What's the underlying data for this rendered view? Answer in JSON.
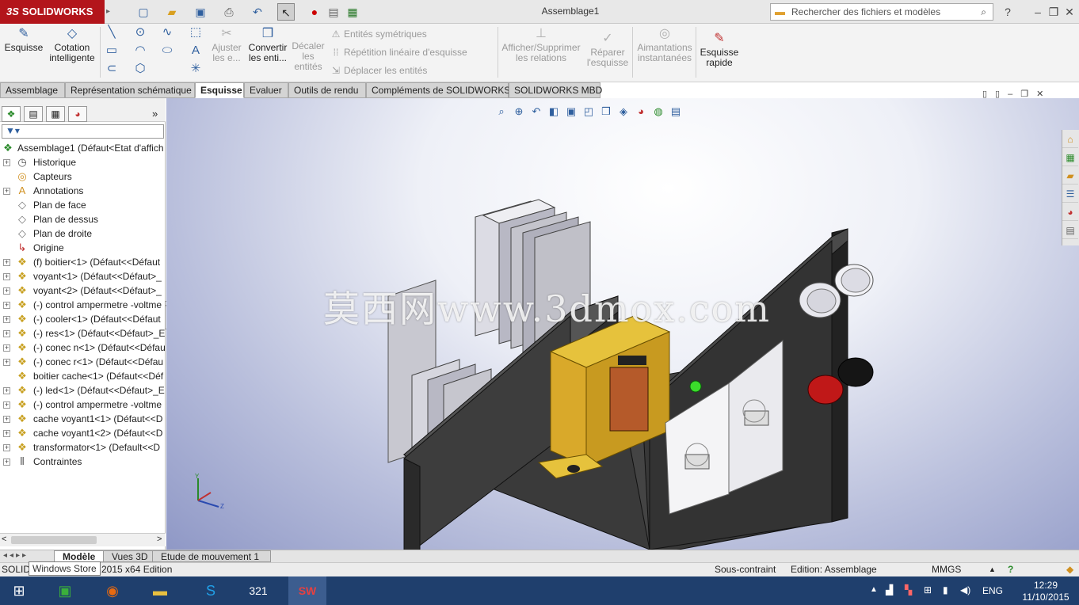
{
  "app": {
    "brand": "SOLIDWORKS",
    "brand_prefix": "3S",
    "document_title": "Assemblage1",
    "search_placeholder": "Rechercher des fichiers et modèles",
    "help": "?"
  },
  "ribbon": {
    "sketch": "Esquisse",
    "smart_dim_1": "Cotation",
    "smart_dim_2": "intelligente",
    "trim_1": "Ajuster",
    "trim_2": "les e...",
    "convert_1": "Convertir",
    "convert_2": "les enti...",
    "offset_1": "Décaler",
    "offset_2": "les",
    "offset_3": "entités",
    "mirror": "Entités symétriques",
    "linear_pattern": "Répétition linéaire d'esquisse",
    "move": "Déplacer les entités",
    "relations_1": "Afficher/Supprimer",
    "relations_2": "les relations",
    "repair_1": "Réparer",
    "repair_2": "l'esquisse",
    "snaps_1": "Aimantations",
    "snaps_2": "instantanées",
    "rapid_1": "Esquisse",
    "rapid_2": "rapide"
  },
  "tabs": [
    "Assemblage",
    "Représentation schématique",
    "Esquisse",
    "Evaluer",
    "Outils de rendu",
    "Compléments de SOLIDWORKS",
    "SOLIDWORKS MBD"
  ],
  "active_tab": "Esquisse",
  "feature_tree": {
    "root": "Assemblage1  (Défaut<Etat d'affich",
    "items": [
      {
        "label": "Historique",
        "icon": "history-icon",
        "expand": true
      },
      {
        "label": "Capteurs",
        "icon": "sensor-icon",
        "expand": false
      },
      {
        "label": "Annotations",
        "icon": "annotation-icon",
        "expand": true
      },
      {
        "label": "Plan de face",
        "icon": "plane-icon",
        "expand": false
      },
      {
        "label": "Plan de dessus",
        "icon": "plane-icon",
        "expand": false
      },
      {
        "label": "Plan de droite",
        "icon": "plane-icon",
        "expand": false
      },
      {
        "label": "Origine",
        "icon": "origin-icon",
        "expand": false
      },
      {
        "label": "(f) boitier<1> (Défaut<<Défaut",
        "icon": "part-icon",
        "expand": true
      },
      {
        "label": "voyant<1> (Défaut<<Défaut>_",
        "icon": "part-icon",
        "expand": true
      },
      {
        "label": "voyant<2> (Défaut<<Défaut>_",
        "icon": "part-icon",
        "expand": true
      },
      {
        "label": "(-) control ampermetre -voltme",
        "icon": "part-icon",
        "expand": true
      },
      {
        "label": "(-) cooler<1> (Défaut<<Défaut",
        "icon": "part-icon",
        "expand": true
      },
      {
        "label": "(-) res<1> (Défaut<<Défaut>_E",
        "icon": "part-icon",
        "expand": true
      },
      {
        "label": "(-) conec n<1> (Défaut<<Défau",
        "icon": "part-icon",
        "expand": true
      },
      {
        "label": "(-) conec r<1> (Défaut<<Défau",
        "icon": "part-icon",
        "expand": true
      },
      {
        "label": "boitier cache<1> (Défaut<<Déf",
        "icon": "part-icon",
        "expand": false
      },
      {
        "label": "(-) led<1> (Défaut<<Défaut>_E",
        "icon": "part-icon",
        "expand": true
      },
      {
        "label": "(-) control ampermetre -voltme",
        "icon": "part-icon",
        "expand": true
      },
      {
        "label": "cache voyant1<1> (Défaut<<D",
        "icon": "part-icon",
        "expand": true
      },
      {
        "label": "cache voyant1<2> (Défaut<<D",
        "icon": "part-icon",
        "expand": true
      },
      {
        "label": "transformator<1> (Default<<D",
        "icon": "part-icon",
        "expand": true
      },
      {
        "label": "Contraintes",
        "icon": "mates-icon",
        "expand": true
      }
    ]
  },
  "watermark": "莫西网www.3dmox.com",
  "bottom_tabs": [
    "Modèle",
    "Vues 3D",
    "Etude de mouvement 1"
  ],
  "status": {
    "left": "SOLID",
    "edition": "2015 x64 Edition",
    "tooltip": "Windows Store",
    "constraint": "Sous-contraint",
    "editing": "Edition: Assemblage",
    "units": "MMGS"
  },
  "taskbar": {
    "lang": "ENG",
    "time": "12:29",
    "date": "11/10/2015"
  },
  "colors": {
    "brand": "#b3151b",
    "accent": "#2f5f9e",
    "taskbar": "#1f3f6d"
  }
}
